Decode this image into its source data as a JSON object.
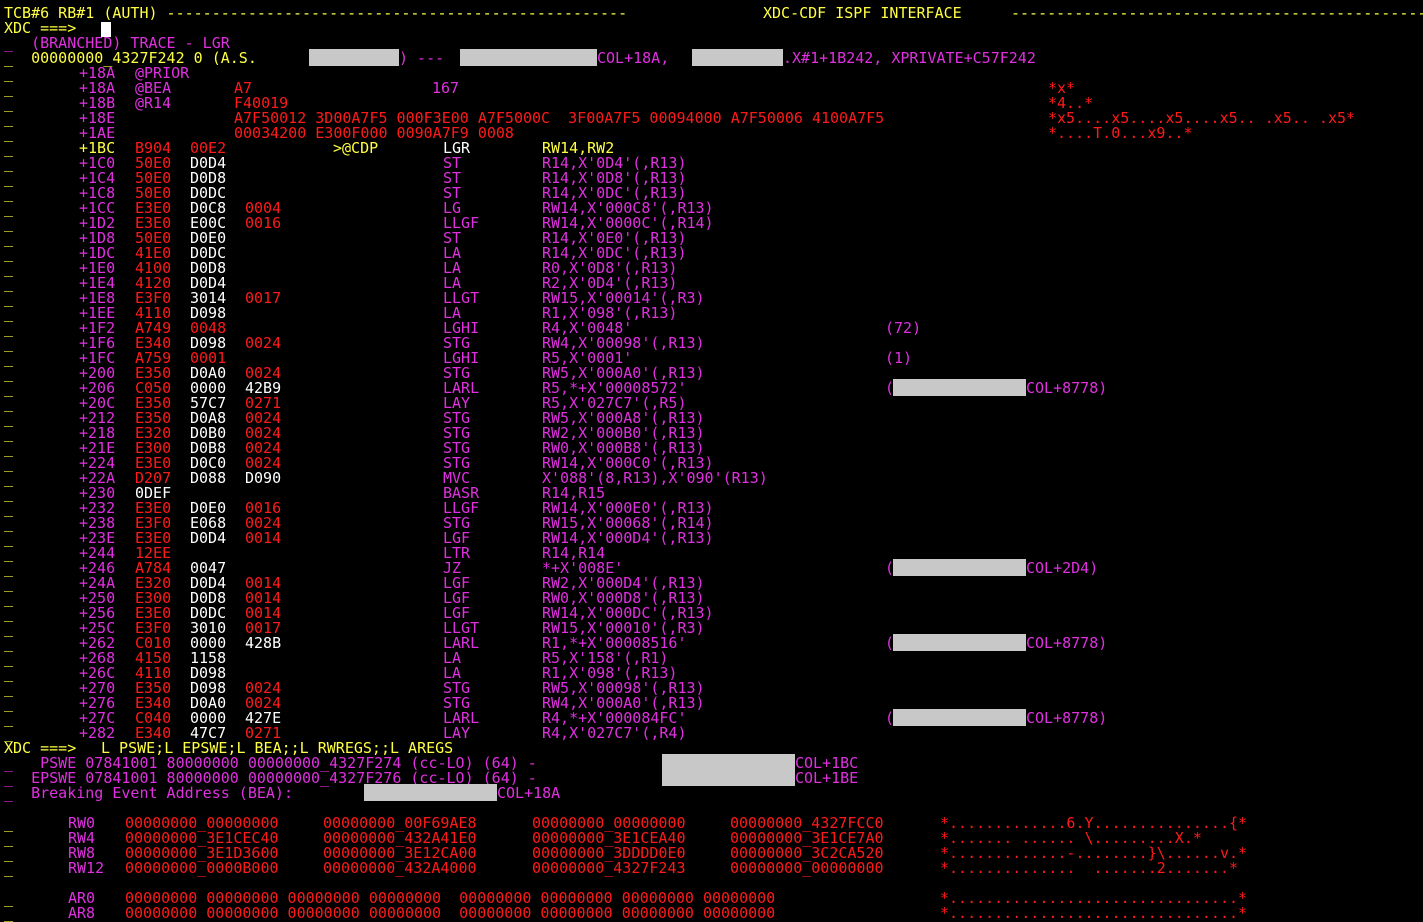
{
  "header": {
    "left": "TCB#6 RB#1 (AUTH) ---------------------------------------------------",
    "center": "XDC-CDF ISPF INTERFACE",
    "right": "-----------------------------------------------"
  },
  "cmd1": {
    "prompt": "XDC ===>",
    "value": ""
  },
  "trace": {
    "line1": "_  (BRANCHED) TRACE - LGR",
    "loc_prefix": "_  00000000_4327F242 0 (A.S.",
    "loc_mid": ") ---",
    "loc_col": "COL+18A,",
    "loc_tail": ".X#1+1B242, XPRIVATE+C57F242"
  },
  "vars": [
    {
      "off": "+18A",
      "name": "@PRIOR",
      "val": "",
      "dec": "",
      "chars": "",
      "off_color": "m"
    },
    {
      "off": "+18A",
      "name": "@BEA",
      "val": "A7",
      "dec": "167",
      "chars": "*x*"
    },
    {
      "off": "+18B",
      "name": "@R14",
      "val": "F40019",
      "dec": "",
      "chars": "*4..*"
    },
    {
      "off": "+18E",
      "name": "",
      "val": "A7F50012 3D00A7F5 000F3E00 A7F5000C  3F00A7F5 00094000 A7F50006 4100A7F5",
      "dec": "",
      "chars": "*x5....x5....x5....x5.. .x5.. .x5*"
    },
    {
      "off": "+1AE",
      "name": "",
      "val": "00034200 E300F000 0090A7F9 0008",
      "dec": "",
      "chars": "*....T.0...x9..*"
    }
  ],
  "instructions": [
    {
      "off": "+1BC",
      "op": "B904",
      "b": "00E2",
      "c": "",
      "d": "",
      "mark": ">@CDP",
      "mn": "LGR",
      "arg": "RW14,RW2",
      "cur": true
    },
    {
      "off": "+1C0",
      "op": "50E0",
      "b": "D0D4",
      "c": "",
      "d": "",
      "mn": "ST",
      "arg": "R14,X'0D4'(,R13)"
    },
    {
      "off": "+1C4",
      "op": "50E0",
      "b": "D0D8",
      "c": "",
      "d": "",
      "mn": "ST",
      "arg": "R14,X'0D8'(,R13)"
    },
    {
      "off": "+1C8",
      "op": "50E0",
      "b": "D0DC",
      "c": "",
      "d": "",
      "mn": "ST",
      "arg": "R14,X'0DC'(,R13)"
    },
    {
      "off": "+1CC",
      "op": "E3E0",
      "b": "D0C8",
      "c": "0004",
      "d": "",
      "mn": "LG",
      "arg": "RW14,X'000C8'(,R13)"
    },
    {
      "off": "+1D2",
      "op": "E3E0",
      "b": "E00C",
      "c": "0016",
      "d": "",
      "mn": "LLGF",
      "arg": "RW14,X'0000C'(,R14)"
    },
    {
      "off": "+1D8",
      "op": "50E0",
      "b": "D0E0",
      "c": "",
      "d": "",
      "mn": "ST",
      "arg": "R14,X'0E0'(,R13)"
    },
    {
      "off": "+1DC",
      "op": "41E0",
      "b": "D0DC",
      "c": "",
      "d": "",
      "mn": "LA",
      "arg": "R14,X'0DC'(,R13)"
    },
    {
      "off": "+1E0",
      "op": "4100",
      "b": "D0D8",
      "c": "",
      "d": "",
      "mn": "LA",
      "arg": "R0,X'0D8'(,R13)"
    },
    {
      "off": "+1E4",
      "op": "4120",
      "b": "D0D4",
      "c": "",
      "d": "",
      "mn": "LA",
      "arg": "R2,X'0D4'(,R13)"
    },
    {
      "off": "+1E8",
      "op": "E3F0",
      "b": "3014",
      "c": "0017",
      "d": "",
      "mn": "LLGT",
      "arg": "RW15,X'00014'(,R3)"
    },
    {
      "off": "+1EE",
      "op": "4110",
      "b": "D098",
      "c": "",
      "d": "",
      "mn": "LA",
      "arg": "R1,X'098'(,R13)"
    },
    {
      "off": "+1F2",
      "op": "A749",
      "b": "0048",
      "c": "",
      "d": "",
      "mn": "LGHI",
      "arg": "R4,X'0048'",
      "cmt": "(72)",
      "b_red": true
    },
    {
      "off": "+1F6",
      "op": "E340",
      "b": "D098",
      "c": "0024",
      "d": "",
      "mn": "STG",
      "arg": "RW4,X'00098'(,R13)"
    },
    {
      "off": "+1FC",
      "op": "A759",
      "b": "0001",
      "c": "",
      "d": "",
      "mn": "LGHI",
      "arg": "R5,X'0001'",
      "cmt": "(1)",
      "b_red": true
    },
    {
      "off": "+200",
      "op": "E350",
      "b": "D0A0",
      "c": "0024",
      "d": "",
      "mn": "STG",
      "arg": "RW5,X'000A0'(,R13)"
    },
    {
      "off": "+206",
      "op": "C050",
      "b": "0000",
      "c": "42B9",
      "d": "",
      "mn": "LARL",
      "arg": "R5,*+X'00008572'",
      "cmt_col": "COL+8778)",
      "mask": true,
      "c_white": true
    },
    {
      "off": "+20C",
      "op": "E350",
      "b": "57C7",
      "c": "0271",
      "d": "",
      "mn": "LAY",
      "arg": "R5,X'027C7'(,R5)"
    },
    {
      "off": "+212",
      "op": "E350",
      "b": "D0A8",
      "c": "0024",
      "d": "",
      "mn": "STG",
      "arg": "RW5,X'000A8'(,R13)"
    },
    {
      "off": "+218",
      "op": "E320",
      "b": "D0B0",
      "c": "0024",
      "d": "",
      "mn": "STG",
      "arg": "RW2,X'000B0'(,R13)"
    },
    {
      "off": "+21E",
      "op": "E300",
      "b": "D0B8",
      "c": "0024",
      "d": "",
      "mn": "STG",
      "arg": "RW0,X'000B8'(,R13)"
    },
    {
      "off": "+224",
      "op": "E3E0",
      "b": "D0C0",
      "c": "0024",
      "d": "",
      "mn": "STG",
      "arg": "RW14,X'000C0'(,R13)"
    },
    {
      "off": "+22A",
      "op": "D207",
      "b": "D088",
      "c": "D090",
      "d": "",
      "mn": "MVC",
      "arg": "X'088'(8,R13),X'090'(R13)",
      "c_white": true
    },
    {
      "off": "+230",
      "op": "0DEF",
      "b": "",
      "c": "",
      "d": "",
      "mn": "BASR",
      "arg": "R14,R15",
      "op_white": true
    },
    {
      "off": "+232",
      "op": "E3E0",
      "b": "D0E0",
      "c": "0016",
      "d": "",
      "mn": "LLGF",
      "arg": "RW14,X'000E0'(,R13)"
    },
    {
      "off": "+238",
      "op": "E3F0",
      "b": "E068",
      "c": "0024",
      "d": "",
      "mn": "STG",
      "arg": "RW15,X'00068'(,R14)"
    },
    {
      "off": "+23E",
      "op": "E3E0",
      "b": "D0D4",
      "c": "0014",
      "d": "",
      "mn": "LGF",
      "arg": "RW14,X'000D4'(,R13)"
    },
    {
      "off": "+244",
      "op": "12EE",
      "b": "",
      "c": "",
      "d": "",
      "mn": "LTR",
      "arg": "R14,R14"
    },
    {
      "off": "+246",
      "op": "A784",
      "b": "0047",
      "c": "",
      "d": "",
      "mn": "JZ",
      "arg": "*+X'008E'",
      "cmt_col": "COL+2D4)",
      "mask": true
    },
    {
      "off": "+24A",
      "op": "E320",
      "b": "D0D4",
      "c": "0014",
      "d": "",
      "mn": "LGF",
      "arg": "RW2,X'000D4'(,R13)"
    },
    {
      "off": "+250",
      "op": "E300",
      "b": "D0D8",
      "c": "0014",
      "d": "",
      "mn": "LGF",
      "arg": "RW0,X'000D8'(,R13)"
    },
    {
      "off": "+256",
      "op": "E3E0",
      "b": "D0DC",
      "c": "0014",
      "d": "",
      "mn": "LGF",
      "arg": "RW14,X'000DC'(,R13)"
    },
    {
      "off": "+25C",
      "op": "E3F0",
      "b": "3010",
      "c": "0017",
      "d": "",
      "mn": "LLGT",
      "arg": "RW15,X'00010'(,R3)"
    },
    {
      "off": "+262",
      "op": "C010",
      "b": "0000",
      "c": "428B",
      "d": "",
      "mn": "LARL",
      "arg": "R1,*+X'00008516'",
      "cmt_col": "COL+8778)",
      "mask": true,
      "c_white": true
    },
    {
      "off": "+268",
      "op": "4150",
      "b": "1158",
      "c": "",
      "d": "",
      "mn": "LA",
      "arg": "R5,X'158'(,R1)"
    },
    {
      "off": "+26C",
      "op": "4110",
      "b": "D098",
      "c": "",
      "d": "",
      "mn": "LA",
      "arg": "R1,X'098'(,R13)"
    },
    {
      "off": "+270",
      "op": "E350",
      "b": "D098",
      "c": "0024",
      "d": "",
      "mn": "STG",
      "arg": "RW5,X'00098'(,R13)"
    },
    {
      "off": "+276",
      "op": "E340",
      "b": "D0A0",
      "c": "0024",
      "d": "",
      "mn": "STG",
      "arg": "RW4,X'000A0'(,R13)"
    },
    {
      "off": "+27C",
      "op": "C040",
      "b": "0000",
      "c": "427E",
      "d": "",
      "mn": "LARL",
      "arg": "R4,*+X'000084FC'",
      "cmt_col": "COL+8778)",
      "mask": true,
      "c_white": true
    },
    {
      "off": "+282",
      "op": "E340",
      "b": "47C7",
      "c": "0271",
      "d": "",
      "mn": "LAY",
      "arg": "R4,X'027C7'(,R4)"
    }
  ],
  "cmd2": {
    "prompt": "XDC ===>",
    "value": "L PSWE;L EPSWE;L BEA;;L RWREGS;;L AREGS"
  },
  "psw": [
    {
      "label": "_   PSWE 07841001 80000000 00000000_4327F274 (cc-LO) (64) -",
      "col": "COL+1BC"
    },
    {
      "label": "_  EPSWE 07841001 80000000 00000000_4327F276 (cc-LO) (64) -",
      "col": "COL+1BE"
    }
  ],
  "bea": {
    "label": "_  Breaking Event Address (BEA):",
    "col": "COL+18A"
  },
  "rwregs": [
    {
      "name": "RW0",
      "v1": "00000000_00000000",
      "v2": "00000000_00F69AE8",
      "v3": "00000000_00000000",
      "v4": "00000000_4327FCC0",
      "chars": "*.............6.Y...............{*"
    },
    {
      "name": "RW4",
      "v1": "00000000_3E1CEC40",
      "v2": "00000000_432A41E0",
      "v3": "00000000_3E1CEA40",
      "v4": "00000000_3E1CE7A0",
      "chars": "*....... ...... \\.........X.*"
    },
    {
      "name": "RW8",
      "v1": "00000000_3E1D3600",
      "v2": "00000000_3E12CA00",
      "v3": "00000000_3DDDD0E0",
      "v4": "00000000_3C2CA520",
      "chars": "*.............-........}\\......v.*"
    },
    {
      "name": "RW12",
      "v1": "00000000_0000B000",
      "v2": "00000000_432A4000",
      "v3": "00000000_4327F243",
      "v4": "00000000_00000000",
      "chars": "*..............  .......2.......*"
    }
  ],
  "aregs": [
    {
      "name": "AR0",
      "vals": "00000000 00000000 00000000 00000000  00000000 00000000 00000000 00000000",
      "chars": "*................................*"
    },
    {
      "name": "AR8",
      "vals": "00000000 00000000 00000000 00000000  00000000 00000000 00000000 00000000",
      "chars": "*................................*"
    }
  ],
  "colors": {
    "yellow": "#ffff44",
    "magenta": "#e030e0",
    "red": "#ff1a1a",
    "white": "#ffffff",
    "mask": "#c8c8c8",
    "background": "#000000"
  }
}
